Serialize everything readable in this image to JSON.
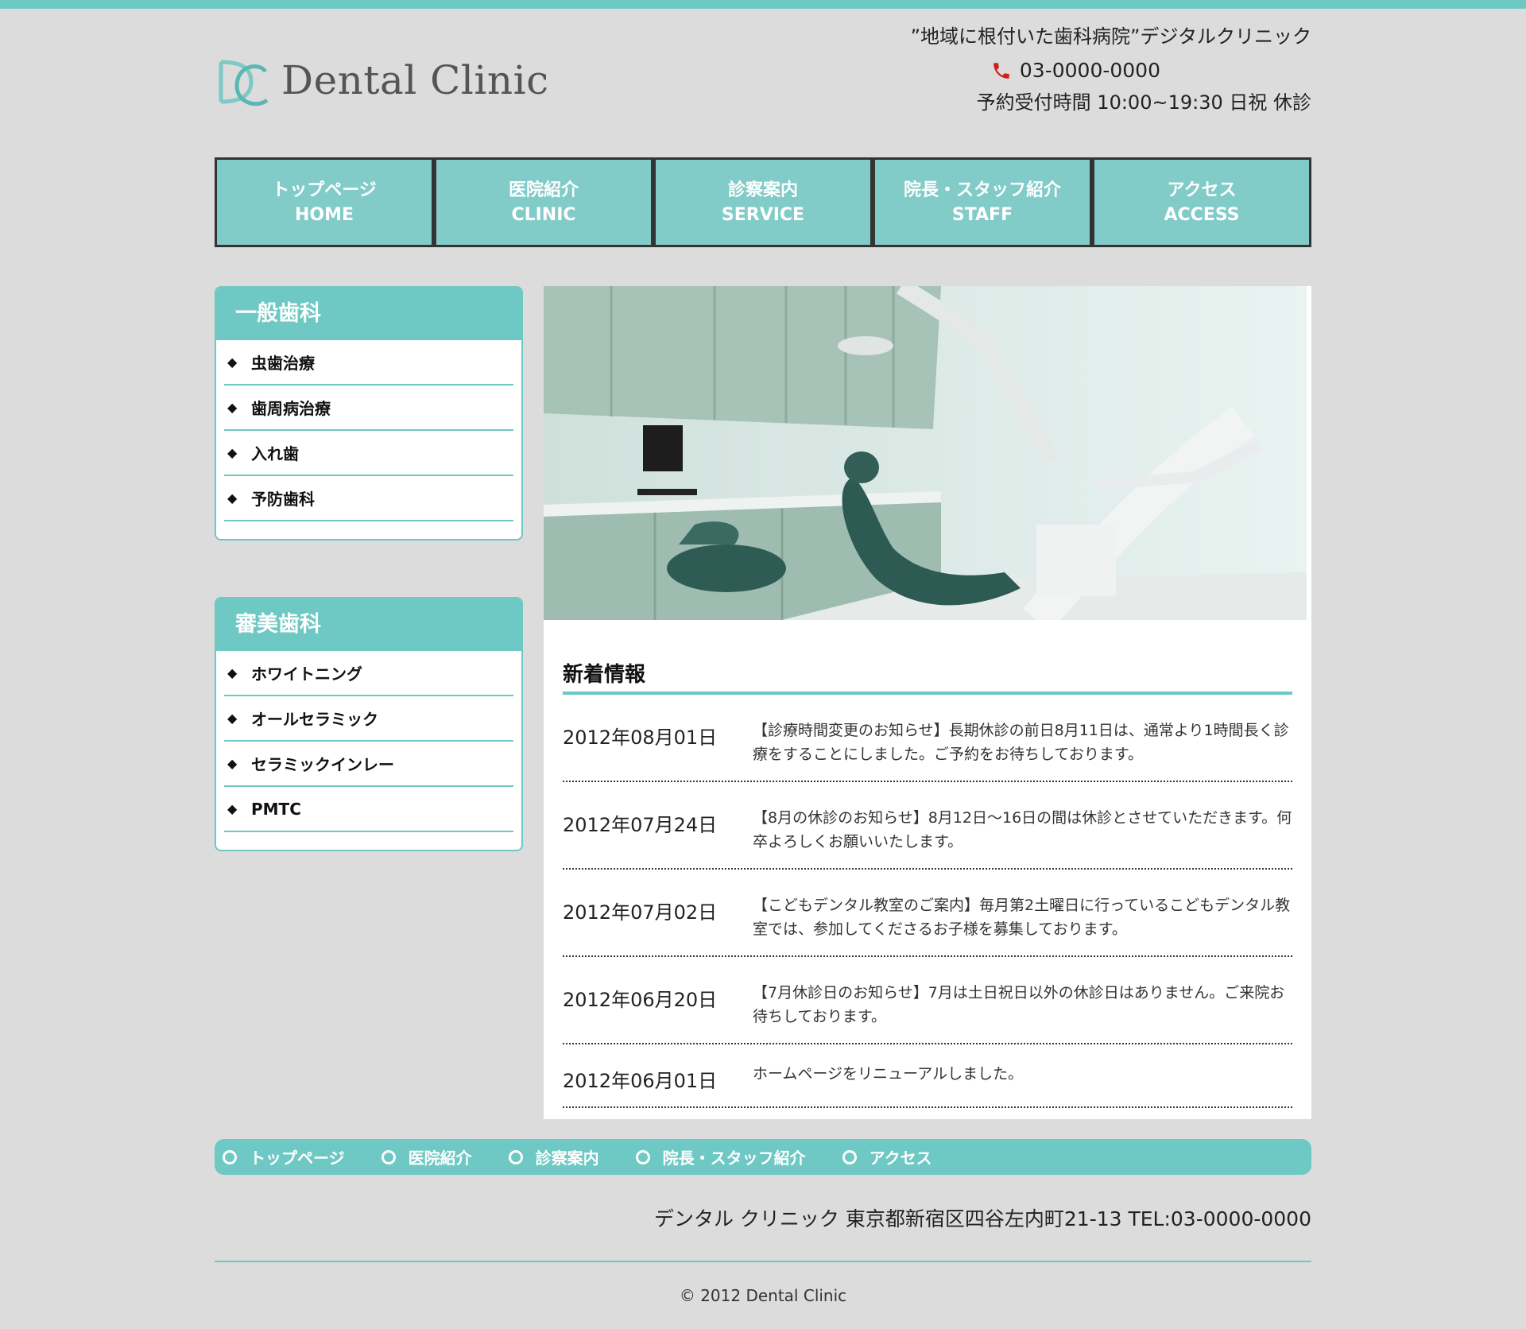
{
  "header": {
    "logo_text": "Dental Clinic",
    "tagline": "”地域に根付いた歯科病院”デジタルクリニック",
    "phone": "03-0000-0000",
    "hours": "予約受付時間 10:00~19:30 日祝 休診"
  },
  "nav": [
    {
      "jp": "トップページ",
      "en": "HOME"
    },
    {
      "jp": "医院紹介",
      "en": "CLINIC"
    },
    {
      "jp": "診察案内",
      "en": "SERVICE"
    },
    {
      "jp": "院長・スタッフ紹介",
      "en": "STAFF"
    },
    {
      "jp": "アクセス",
      "en": "ACCESS"
    }
  ],
  "sidebar": [
    {
      "title": "一般歯科",
      "items": [
        "虫歯治療",
        "歯周病治療",
        "入れ歯",
        "予防歯科"
      ]
    },
    {
      "title": "審美歯科",
      "items": [
        "ホワイトニング",
        "オールセラミック",
        "セラミックインレー",
        "PMTC"
      ]
    }
  ],
  "news": {
    "title": "新着情報",
    "items": [
      {
        "date": "2012年08月01日",
        "text": "【診療時間変更のお知らせ】長期休診の前日8月11日は、通常より1時間長く診療をすることにしました。ご予約をお待ちしております。"
      },
      {
        "date": "2012年07月24日",
        "text": "【8月の休診のお知らせ】8月12日〜16日の間は休診とさせていただきます。何卒よろしくお願いいたします。"
      },
      {
        "date": "2012年07月02日",
        "text": "【こどもデンタル教室のご案内】毎月第2土曜日に行っているこどもデンタル教室では、参加してくださるお子様を募集しております。"
      },
      {
        "date": "2012年06月20日",
        "text": "【7月休診日のお知らせ】7月は土日祝日以外の休診日はありません。ご来院お待ちしております。"
      },
      {
        "date": "2012年06月01日",
        "text": "ホームページをリニューアルしました。"
      }
    ]
  },
  "footer": {
    "nav": [
      "トップページ",
      "医院紹介",
      "診察案内",
      "院長・スタッフ紹介",
      "アクセス"
    ],
    "address": "デンタル クリニック 東京都新宿区四谷左内町21-13 TEL:03-0000-0000",
    "copyright": "© 2012 Dental Clinic"
  },
  "colors": {
    "accent": "#6ec8c4",
    "nav_bg": "#81cbc8",
    "page_bg": "#dcdcdc"
  },
  "icons": {
    "phone": "phone-icon",
    "bullet": "diamond-icon",
    "footer_bullet": "circle-icon"
  }
}
